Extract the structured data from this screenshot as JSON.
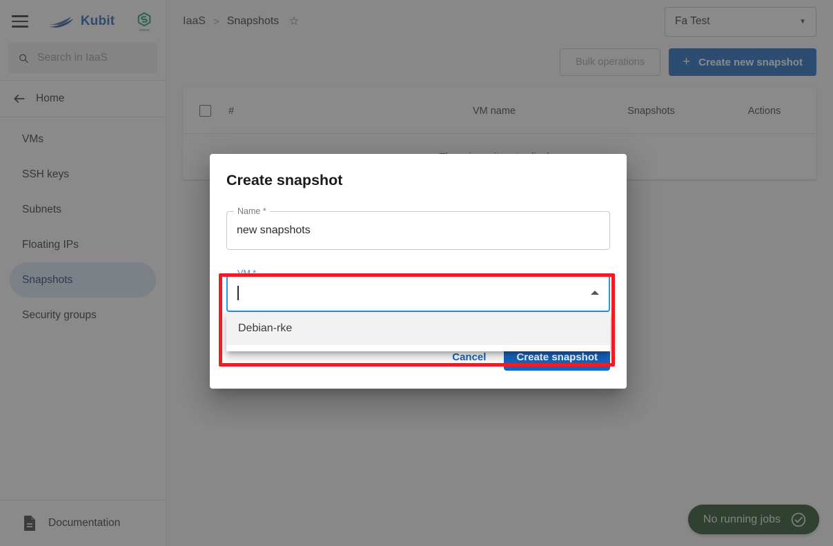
{
  "sidebar": {
    "brand_name": "Kubit",
    "brand_logo_icon": "boat-logo-icon",
    "company_logo_icon": "hexagon-s-logo-icon",
    "menu_icon": "hamburger-menu-icon",
    "search": {
      "placeholder": "Search in IaaS",
      "value": "",
      "icon": "search-icon"
    },
    "home_label": "Home",
    "home_icon": "arrow-left-icon",
    "items": [
      {
        "label": "VMs",
        "active": false
      },
      {
        "label": "SSH keys",
        "active": false
      },
      {
        "label": "Subnets",
        "active": false
      },
      {
        "label": "Floating IPs",
        "active": false
      },
      {
        "label": "Snapshots",
        "active": true
      },
      {
        "label": "Security groups",
        "active": false
      }
    ],
    "documentation_label": "Documentation",
    "documentation_icon": "document-icon"
  },
  "header": {
    "breadcrumb": {
      "root": "IaaS",
      "separator": ">",
      "current": "Snapshots",
      "favorite_icon": "star-outline-icon"
    },
    "project_selector": {
      "value": "Fa Test",
      "caret_icon": "chevron-down-icon"
    }
  },
  "actions": {
    "bulk_operations_label": "Bulk operations",
    "create_new_snapshot_label": "Create new snapshot",
    "plus_icon": "plus-icon"
  },
  "table": {
    "columns": [
      "#",
      "VM name",
      "Snapshots",
      "Actions"
    ],
    "select_all_icon": "checkbox-unchecked-icon",
    "empty_message": "There is no item to display",
    "rows": []
  },
  "status_chip": {
    "label": "No running jobs",
    "icon": "check-circle-icon",
    "color": "#1e4620"
  },
  "dialog": {
    "title": "Create snapshot",
    "name_field": {
      "label": "Name *",
      "value": "new snapshots"
    },
    "vm_field": {
      "label": "VM *",
      "value": "",
      "focused": true,
      "expanded": true,
      "toggle_icon": "triangle-up-icon",
      "options": [
        "Debian-rke"
      ]
    },
    "cancel_label": "Cancel",
    "submit_label": "Create snapshot"
  },
  "annotation": {
    "highlight_color": "#ee1c25"
  }
}
